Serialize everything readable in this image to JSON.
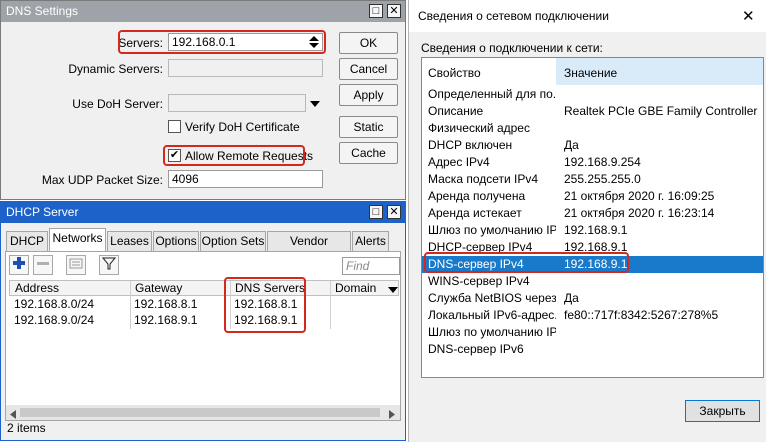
{
  "dns": {
    "title": "DNS Settings",
    "servers_label": "Servers:",
    "servers_value": "192.168.0.1",
    "dynamic_label": "Dynamic Servers:",
    "doh_label": "Use DoH Server:",
    "verify_label": "Verify DoH Certificate",
    "allow_label": "Allow Remote Requests",
    "udp_label": "Max UDP Packet Size:",
    "udp_value": "4096",
    "buttons": {
      "ok": "OK",
      "cancel": "Cancel",
      "apply": "Apply",
      "static": "Static",
      "cache": "Cache"
    }
  },
  "dhcp": {
    "title": "DHCP Server",
    "tabs": [
      "DHCP",
      "Networks",
      "Leases",
      "Options",
      "Option Sets",
      "Vendor Classes",
      "Alerts"
    ],
    "find_placeholder": "Find",
    "columns": [
      "Address",
      "Gateway",
      "DNS Servers",
      "Domain"
    ],
    "rows": [
      {
        "address": "192.168.8.0/24",
        "gateway": "192.168.8.1",
        "dns": "192.168.8.1"
      },
      {
        "address": "192.168.9.0/24",
        "gateway": "192.168.9.1",
        "dns": "192.168.9.1"
      }
    ],
    "status": "2 items"
  },
  "net": {
    "title": "Сведения о сетевом подключении",
    "subtitle": "Сведения о подключении к сети:",
    "col_prop": "Свойство",
    "col_val": "Значение",
    "rows": [
      {
        "p": "Определенный для по...",
        "v": ""
      },
      {
        "p": "Описание",
        "v": "Realtek PCIe GBE Family Controller"
      },
      {
        "p": "Физический адрес",
        "v": ""
      },
      {
        "p": "DHCP включен",
        "v": "Да"
      },
      {
        "p": "Адрес IPv4",
        "v": "192.168.9.254"
      },
      {
        "p": "Маска подсети IPv4",
        "v": "255.255.255.0"
      },
      {
        "p": "Аренда получена",
        "v": "21 октября 2020 г. 16:09:25"
      },
      {
        "p": "Аренда истекает",
        "v": "21 октября 2020 г. 16:23:14"
      },
      {
        "p": "Шлюз по умолчанию IP...",
        "v": "192.168.9.1"
      },
      {
        "p": "DHCP-сервер IPv4",
        "v": "192.168.9.1"
      },
      {
        "p": "DNS-сервер IPv4",
        "v": "192.168.9.1"
      },
      {
        "p": "WINS-сервер IPv4",
        "v": ""
      },
      {
        "p": "Служба NetBIOS через...",
        "v": "Да"
      },
      {
        "p": "Локальный IPv6-адрес...",
        "v": "fe80::717f:8342:5267:278%5"
      },
      {
        "p": "Шлюз по умолчанию IP...",
        "v": ""
      },
      {
        "p": "DNS-сервер IPv6",
        "v": ""
      }
    ],
    "close_label": "Закрыть",
    "close_x": "✕"
  },
  "colors": {
    "title_active": "#1c62c9",
    "title_inactive": "#9ea3a9",
    "highlight": "#1979ca",
    "annotation": "#d4281e"
  }
}
